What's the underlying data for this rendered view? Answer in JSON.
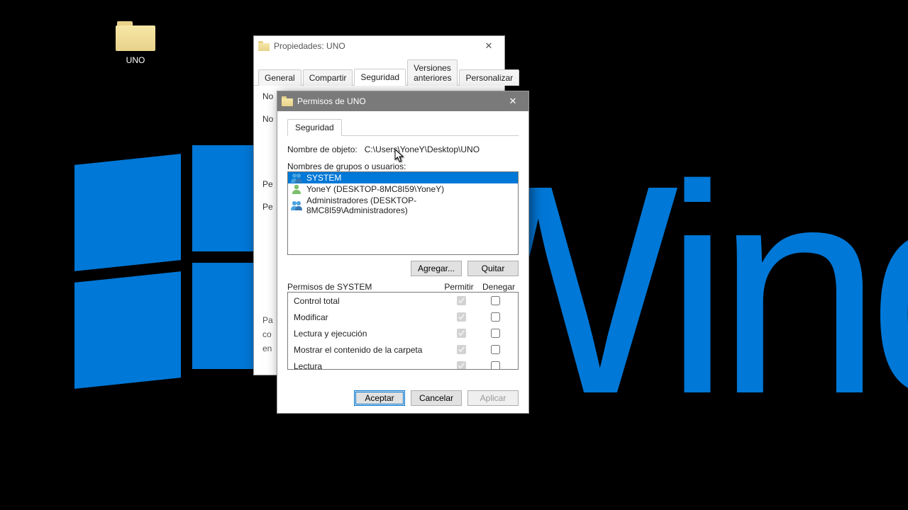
{
  "desktop": {
    "folder_label": "UNO",
    "bg_text": "Wind"
  },
  "props_window": {
    "title": "Propiedades: UNO",
    "tabs": [
      "General",
      "Compartir",
      "Seguridad",
      "Versiones anteriores",
      "Personalizar"
    ],
    "active_tab_index": 2,
    "object_name_prefix": "No",
    "side_labels": [
      "No",
      "Pe",
      "Pe"
    ],
    "footer_lines": [
      "Pa",
      "co",
      "en"
    ]
  },
  "perm_dialog": {
    "title": "Permisos de UNO",
    "tab": "Seguridad",
    "object_label": "Nombre de objeto:",
    "object_path": "C:\\Users\\YoneY\\Desktop\\UNO",
    "groups_label": "Nombres de grupos o usuarios:",
    "groups": [
      {
        "type": "group",
        "name": "SYSTEM",
        "selected": true
      },
      {
        "type": "user",
        "name": "YoneY (DESKTOP-8MC8I59\\YoneY)",
        "selected": false
      },
      {
        "type": "group",
        "name": "Administradores (DESKTOP-8MC8I59\\Administradores)",
        "selected": false
      }
    ],
    "add_button": "Agregar...",
    "remove_button": "Quitar",
    "perm_header_for": "Permisos de SYSTEM",
    "col_allow": "Permitir",
    "col_deny": "Denegar",
    "permissions": [
      {
        "name": "Control total",
        "allow": true,
        "deny": false
      },
      {
        "name": "Modificar",
        "allow": true,
        "deny": false
      },
      {
        "name": "Lectura y ejecución",
        "allow": true,
        "deny": false
      },
      {
        "name": "Mostrar el contenido de la carpeta",
        "allow": true,
        "deny": false
      },
      {
        "name": "Lectura",
        "allow": true,
        "deny": false
      }
    ],
    "ok": "Aceptar",
    "cancel": "Cancelar",
    "apply": "Aplicar"
  }
}
